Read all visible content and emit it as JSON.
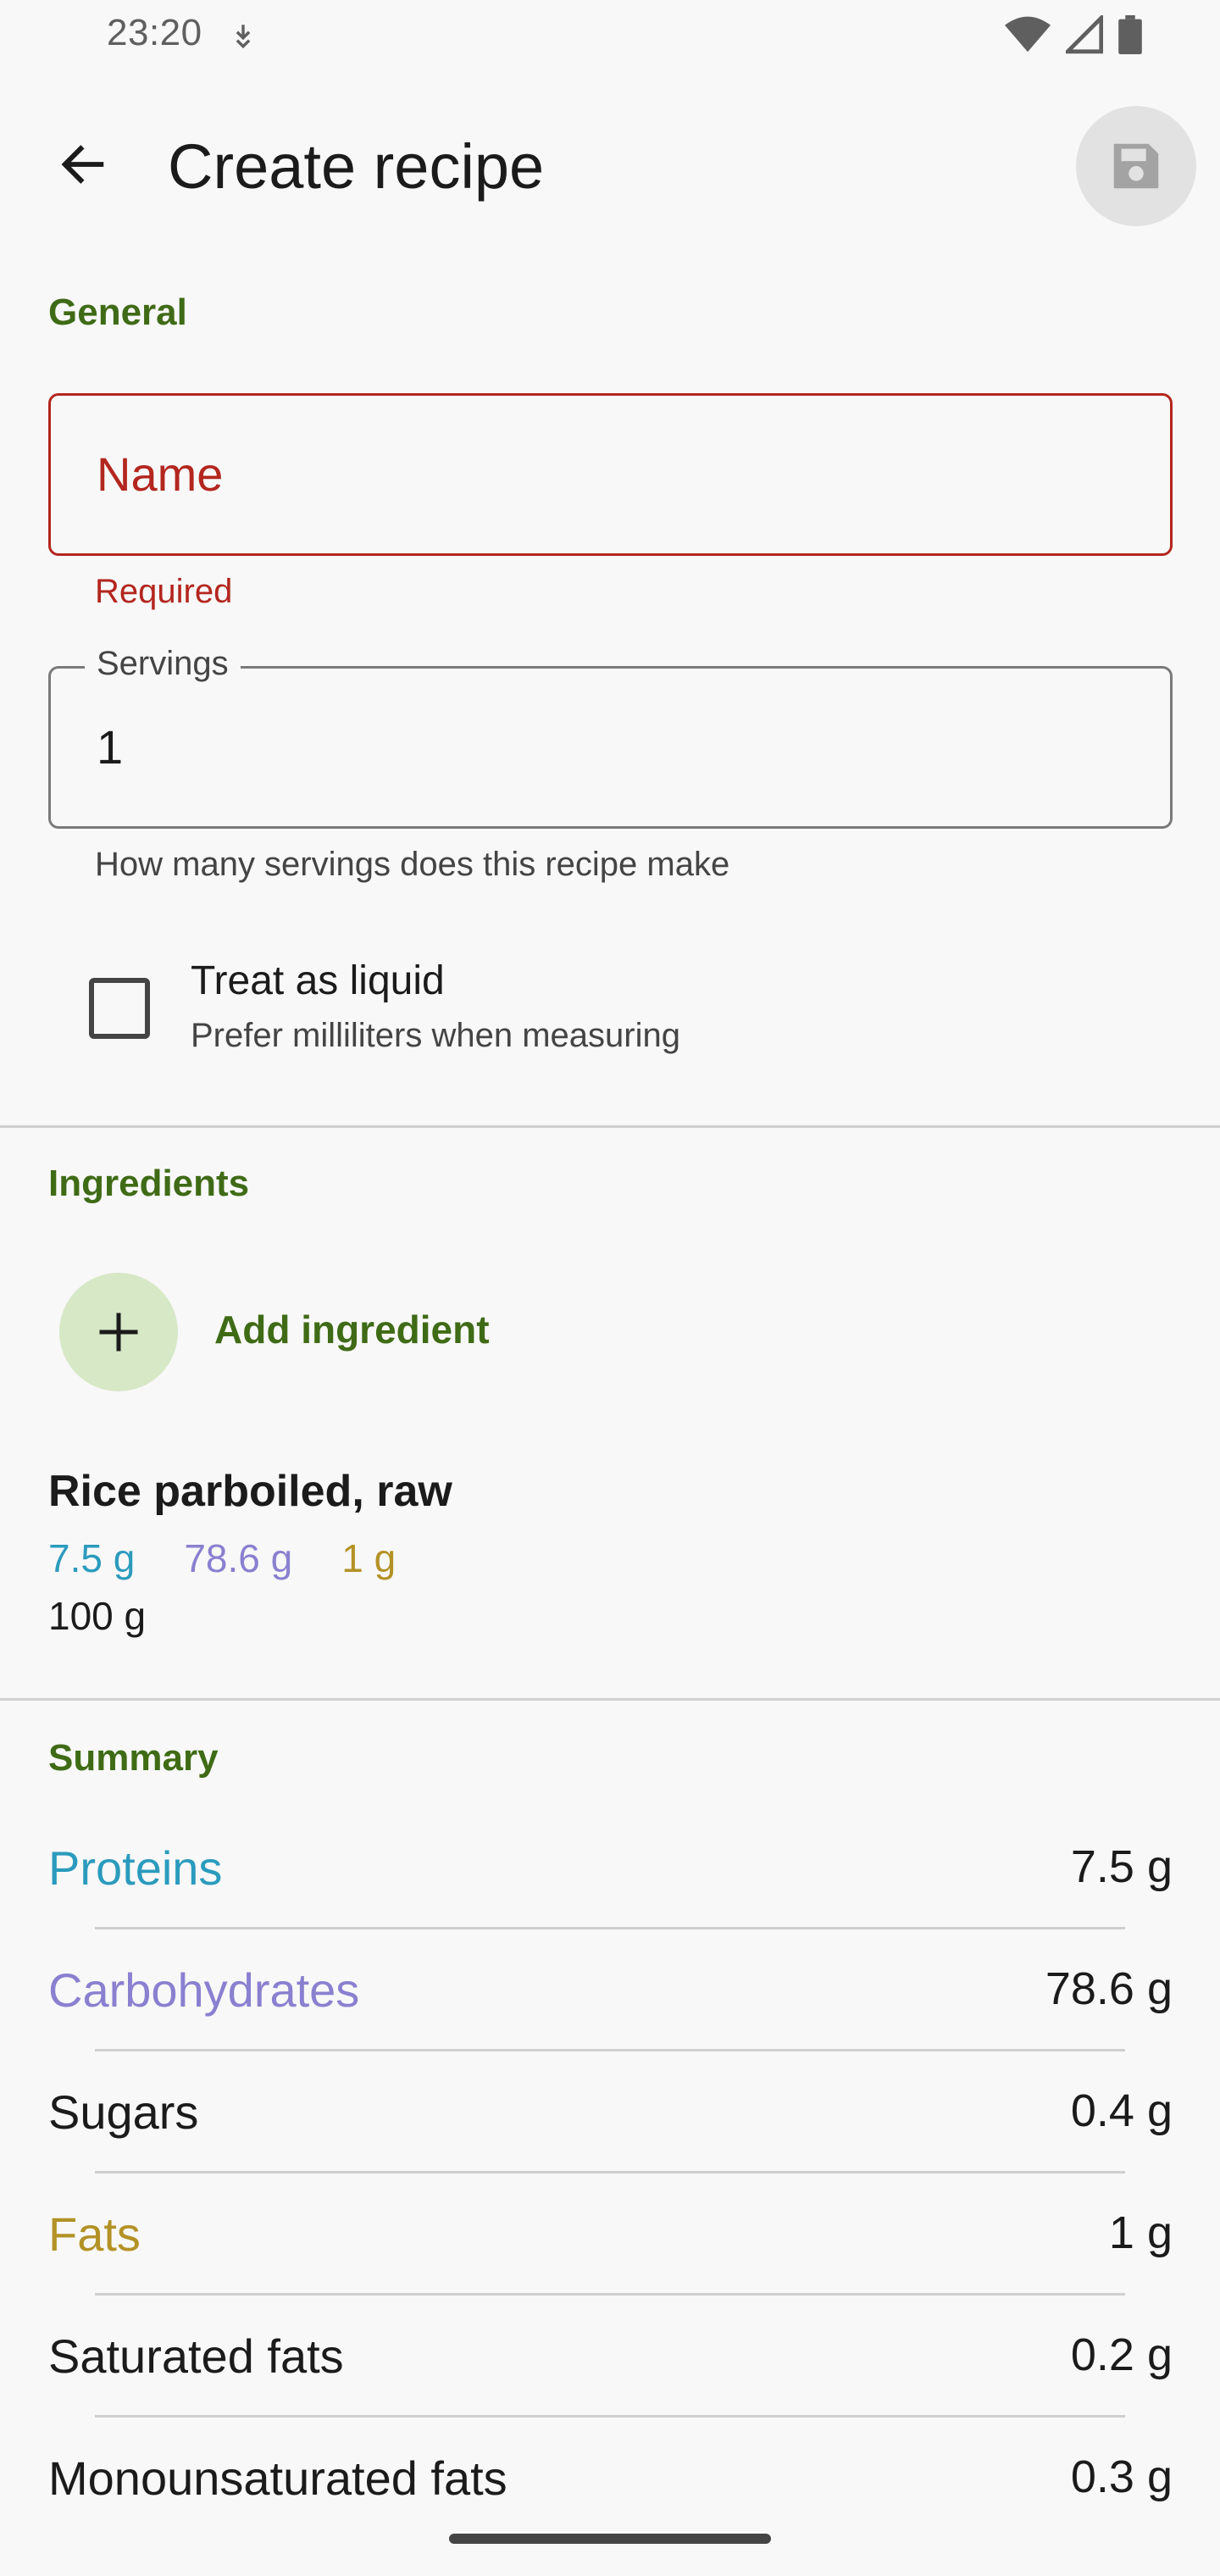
{
  "status_bar": {
    "time": "23:20"
  },
  "app_bar": {
    "title": "Create recipe"
  },
  "general": {
    "section_label": "General",
    "name_label": "Name",
    "name_error": "Required",
    "servings_label": "Servings",
    "servings_value": "1",
    "servings_help": "How many servings does this recipe make",
    "liquid_title": "Treat as liquid",
    "liquid_subtitle": "Prefer milliliters when measuring",
    "liquid_checked": false
  },
  "ingredients": {
    "section_label": "Ingredients",
    "add_label": "Add ingredient",
    "items": [
      {
        "name": "Rice parboiled, raw",
        "protein": "7.5 g",
        "carbs": "78.6 g",
        "fat": "1 g",
        "amount": "100 g"
      }
    ]
  },
  "summary": {
    "section_label": "Summary",
    "rows": [
      {
        "label": "Proteins",
        "value": "7.5 g"
      },
      {
        "label": "Carbohydrates",
        "value": "78.6 g"
      },
      {
        "label": "Sugars",
        "value": "0.4 g"
      },
      {
        "label": "Fats",
        "value": "1 g"
      },
      {
        "label": "Saturated fats",
        "value": "0.2 g"
      },
      {
        "label": "Monounsaturated fats",
        "value": "0.3 g"
      }
    ]
  },
  "colors": {
    "accent": "#3f6b16",
    "error": "#b3261e",
    "protein": "#2b9bbd",
    "carbohydrates": "#8a80d0",
    "fat": "#b39226"
  },
  "icons": {
    "back": "arrow-back-icon",
    "save": "floppy-disk-icon",
    "add": "plus-icon"
  }
}
